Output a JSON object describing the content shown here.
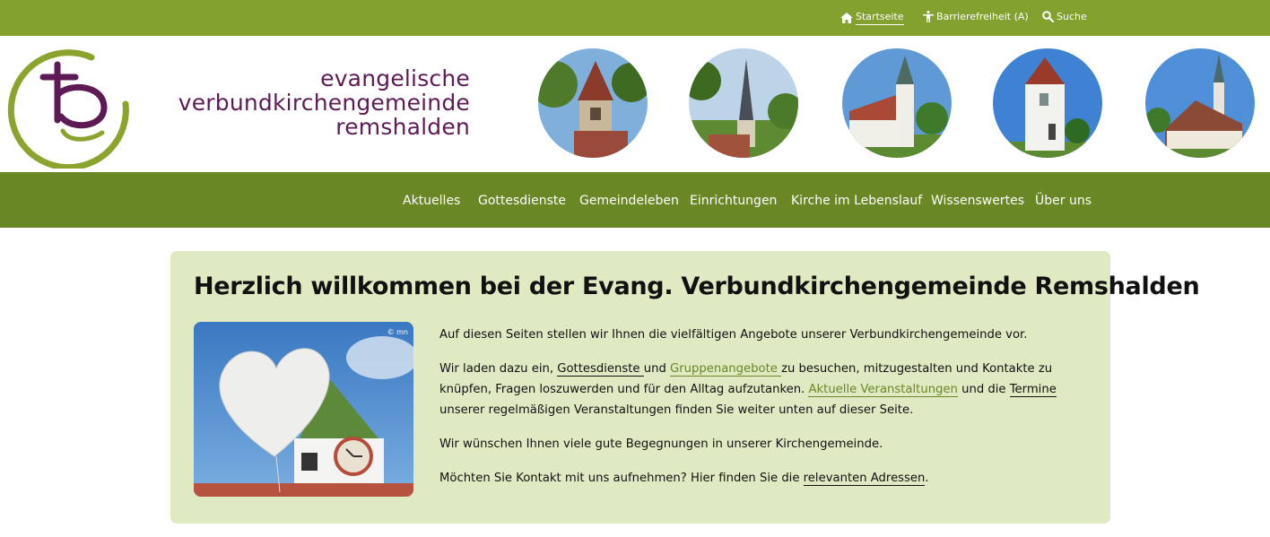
{
  "utility_nav": {
    "home": {
      "label": "Startseite",
      "icon": "home-icon"
    },
    "accessibility": {
      "label": "Barrierefreiheit (A)",
      "icon": "accessibility-icon"
    },
    "search": {
      "label": "Suche",
      "icon": "search-icon"
    }
  },
  "brand": {
    "line1": "evangelische",
    "line2": "verbundkirchengemeinde",
    "line3": "remshalden"
  },
  "main_nav": {
    "items": [
      {
        "label": "Aktuelles"
      },
      {
        "label": "Gottesdienste"
      },
      {
        "label": "Gemeindeleben"
      },
      {
        "label": "Einrichtungen"
      },
      {
        "label": "Kirche im Lebenslauf"
      },
      {
        "label": "Wissenswertes"
      },
      {
        "label": "Über uns"
      }
    ]
  },
  "welcome": {
    "title": "Herzlich willkommen bei der Evang. Verbundkirchengemeinde Remshalden",
    "photo_credit": "© mn",
    "p1": "Auf diesen Seiten stellen wir Ihnen die vielfältigen Angebote unserer Verbundkirchengemeinde vor.",
    "p2": {
      "t1": "Wir laden dazu ein, ",
      "link_services": "Gottesdienste ",
      "t2": "und ",
      "link_groups": "Gruppenangebote ",
      "t3": "zu besuchen, mitzugestalten und Kontakte zu knüpfen, Fragen loszuwerden und für den Alltag aufzutanken. ",
      "link_events": "Aktuelle Veranstaltungen",
      "t4": " und die ",
      "link_dates": "Termine ",
      "t5": "unserer regelmäßigen Veranstaltungen finden Sie weiter unten auf dieser Seite."
    },
    "p3": "Wir wünschen Ihnen viele gute Begegnungen in unserer Kirchengemeinde.",
    "p4": {
      "t1": "Möchten Sie Kontakt mit uns aufnehmen? Hier finden Sie die ",
      "link_addresses": "relevanten Adressen",
      "t2": "."
    }
  },
  "colors": {
    "topbar": "#82a12e",
    "mainnav": "#6a8725",
    "brand_purple": "#5e1a55",
    "welcome_bg": "#dfeac3"
  }
}
